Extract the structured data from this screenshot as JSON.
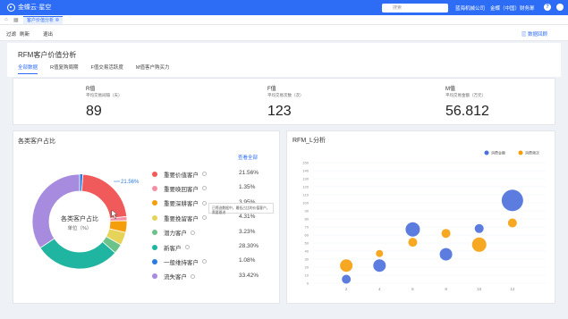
{
  "topbar": {
    "logo": "金蝶云·星空",
    "search_placeholder": "搜索",
    "company": "蓝海机械公司",
    "user": "金蝶（中国）财务部",
    "help": "?",
    "colors": {
      "primary": "#2d6df6"
    }
  },
  "tabbar": {
    "active_tab": "客户价值分析"
  },
  "toolbar": {
    "filter": "过滤",
    "refresh": "刷新",
    "exit": "退出",
    "data_source": "数据回顾"
  },
  "page": {
    "title": "RFM客户价值分析",
    "tabs": [
      "全部数据",
      "R值复购周期",
      "F值交易活跃度",
      "M值客户购买力"
    ]
  },
  "kpis": [
    {
      "name": "R值",
      "sub": "平均交易间隔（天）",
      "value": "89"
    },
    {
      "name": "F值",
      "sub": "平均交易次数（次）",
      "value": "123"
    },
    {
      "name": "M值",
      "sub": "平均交易金额（万元）",
      "value": "56.812"
    }
  ],
  "donut": {
    "title": "各类客户占比",
    "center_title": "各类客户占比",
    "center_sub": "单位（%）",
    "callout": "21.56%",
    "view_all": "查看全部",
    "tooltip": "已筛选数据中，最低占比的价值客户，需要跟进",
    "segments": [
      {
        "name": "重要价值客户",
        "pct": "21.56%",
        "value": 21.56,
        "color": "#f15a5a"
      },
      {
        "name": "重要唤回客户",
        "pct": "1.35%",
        "value": 1.35,
        "color": "#f58fa5"
      },
      {
        "name": "重要深耕客户",
        "pct": "3.95%",
        "value": 3.95,
        "color": "#f59e0b"
      },
      {
        "name": "重要挽留客户",
        "pct": "4.31%",
        "value": 4.31,
        "color": "#e6d35a"
      },
      {
        "name": "潜力客户",
        "pct": "3.23%",
        "value": 3.23,
        "color": "#6cc38a"
      },
      {
        "name": "新客户",
        "pct": "28.30%",
        "value": 28.3,
        "color": "#1fb5a0"
      },
      {
        "name": "一般维持客户",
        "pct": "1.08%",
        "value": 1.08,
        "color": "#2b7be0"
      },
      {
        "name": "流失客户",
        "pct": "33.42%",
        "value": 33.42,
        "color": "#a78bdf"
      }
    ]
  },
  "chart_data": {
    "type": "scatter",
    "title": "RFM_L分析",
    "xlabel": "",
    "ylabel": "",
    "xlim": [
      0,
      14
    ],
    "ylim": [
      0,
      150
    ],
    "x_ticks": [
      2,
      4,
      6,
      8,
      10,
      12
    ],
    "y_ticks": [
      0,
      10,
      20,
      30,
      40,
      50,
      60,
      70,
      80,
      90,
      100,
      110,
      120,
      130,
      140,
      150
    ],
    "y_tick_labels": [
      "0",
      "10",
      "20",
      "30",
      "40",
      "50",
      "60",
      "70",
      "80",
      "90",
      "100",
      "110",
      "120",
      "130",
      "140",
      "150"
    ],
    "legend_position": "top-right",
    "series": [
      {
        "name": "消费金额",
        "color": "#4a6fdc",
        "points": [
          {
            "x": 2,
            "y": 5,
            "size": 5
          },
          {
            "x": 4,
            "y": 22,
            "size": 7
          },
          {
            "x": 6,
            "y": 67,
            "size": 8
          },
          {
            "x": 8,
            "y": 36,
            "size": 7
          },
          {
            "x": 10,
            "y": 68,
            "size": 5
          },
          {
            "x": 12,
            "y": 103,
            "size": 12
          }
        ]
      },
      {
        "name": "消费频次",
        "color": "#f59e0b",
        "points": [
          {
            "x": 2,
            "y": 22,
            "size": 7
          },
          {
            "x": 4,
            "y": 37,
            "size": 4
          },
          {
            "x": 6,
            "y": 51,
            "size": 5
          },
          {
            "x": 8,
            "y": 62,
            "size": 5
          },
          {
            "x": 10,
            "y": 48,
            "size": 8
          },
          {
            "x": 12,
            "y": 75,
            "size": 5
          }
        ]
      }
    ]
  }
}
